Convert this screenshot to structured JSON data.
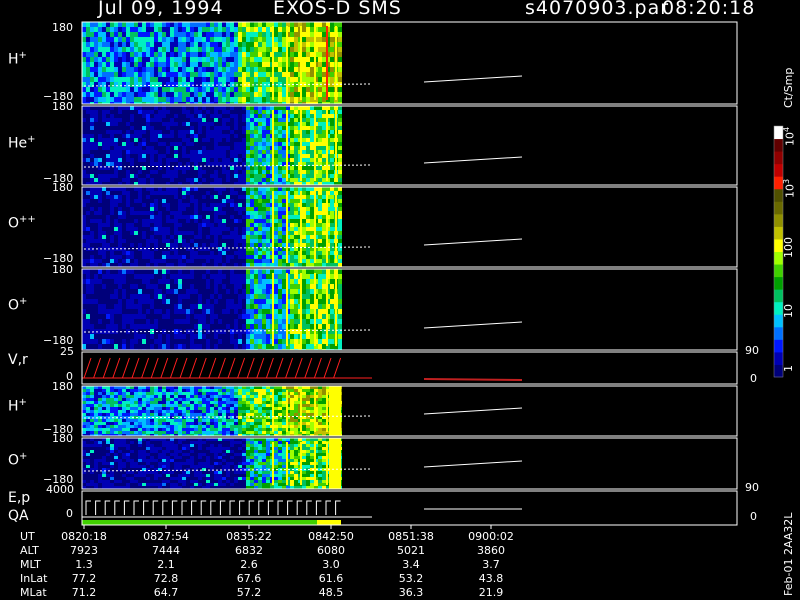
{
  "header": {
    "date": "Jul 09, 1994",
    "instrument": "EXOS-D SMS",
    "filename": "s4070903.par",
    "time": "08:20:18"
  },
  "colorbar": {
    "unit": "Ct/Smp",
    "labels": {
      "t1": "1",
      "t10": "10",
      "t100": "100",
      "t1000": "10",
      "t1000sup": "3",
      "t10000": "10",
      "t10000sup": "4"
    },
    "colors": [
      "#00007a",
      "#0000b4",
      "#0018ff",
      "#0070ff",
      "#00c0ff",
      "#00f0c0",
      "#00c060",
      "#00a000",
      "#40d000",
      "#a0ff00",
      "#ffff00",
      "#c0c000",
      "#909000",
      "#6a6a00",
      "#505000",
      "#ff2000",
      "#c00000",
      "#900000",
      "#600000",
      "#ffffff"
    ]
  },
  "panels": {
    "p1": {
      "label": "H",
      "sup": "+",
      "top": "180",
      "bot": "−180"
    },
    "p2": {
      "label": "He",
      "sup": "+",
      "top": "180",
      "bot": "−180"
    },
    "p3": {
      "label": "O",
      "sup": "++",
      "top": "180",
      "bot": "−180"
    },
    "p4": {
      "label": "O",
      "sup": "+",
      "top": "180",
      "bot": "−180"
    },
    "p5": {
      "label": "V,r",
      "top": "25",
      "bot": "0",
      "right_top": "90",
      "right_bot": "0"
    },
    "p6": {
      "label": "H",
      "sup": "+",
      "top": "180",
      "bot": "−180"
    },
    "p7": {
      "label": "O",
      "sup": "+",
      "top": "180",
      "bot": "−180"
    },
    "p8": {
      "label": "E,p",
      "label2": "QA",
      "top": "4000",
      "bot": "0",
      "right_top": "90",
      "right_bot": "0"
    }
  },
  "table": {
    "row_labels": [
      "UT",
      "ALT",
      "MLT",
      "InLat",
      "MLat"
    ],
    "columns": [
      {
        "UT": "0820:18",
        "ALT": "7923",
        "MLT": "1.3",
        "InLat": "77.2",
        "MLat": "71.2"
      },
      {
        "UT": "0827:54",
        "ALT": "7444",
        "MLT": "2.1",
        "InLat": "72.8",
        "MLat": "64.7"
      },
      {
        "UT": "0835:22",
        "ALT": "6832",
        "MLT": "2.6",
        "InLat": "67.6",
        "MLat": "57.2"
      },
      {
        "UT": "0842:50",
        "ALT": "6080",
        "MLT": "3.0",
        "InLat": "61.6",
        "MLat": "48.5"
      },
      {
        "UT": "0851:38",
        "ALT": "5021",
        "MLT": "3.4",
        "InLat": "53.2",
        "MLat": "36.3"
      },
      {
        "UT": "0900:02",
        "ALT": "3860",
        "MLT": "3.7",
        "InLat": "43.8",
        "MLat": "21.9"
      }
    ]
  },
  "footer": "Feb-01 2AA32L",
  "chart_data": {
    "type": "heatmap",
    "title": "Jul 09, 1994   EXOS-D SMS",
    "x_ticks": [
      "0820:18",
      "0827:54",
      "0835:22",
      "0842:50",
      "0851:38",
      "0900:02"
    ],
    "y_range_pitch": [
      -180,
      180
    ],
    "y_range_vr": [
      0,
      25
    ],
    "y_range_ep": [
      0,
      4000
    ],
    "colorbar_range": [
      1,
      10000
    ],
    "colorbar_scale": "log",
    "series": [
      {
        "name": "H+",
        "data_extent": [
          "0820:18",
          "0842:50"
        ]
      },
      {
        "name": "He+",
        "data_extent": [
          "0820:18",
          "0842:50"
        ]
      },
      {
        "name": "O++",
        "data_extent": [
          "0820:18",
          "0842:50"
        ]
      },
      {
        "name": "O+",
        "data_extent": [
          "0820:18",
          "0842:50"
        ]
      }
    ]
  }
}
